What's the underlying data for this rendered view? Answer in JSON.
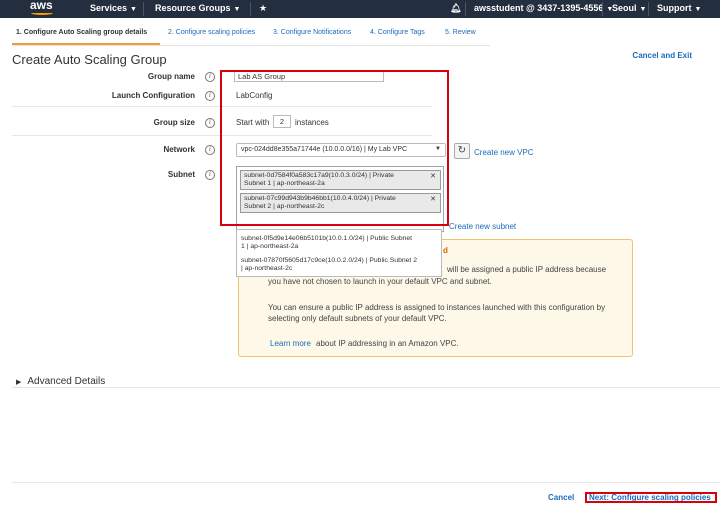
{
  "nav": {
    "logo": "aws",
    "services": "Services",
    "resource_groups": "Resource Groups",
    "account": "awsstudent @ 3437-1395-4556",
    "region": "Seoul",
    "support": "Support"
  },
  "tabs": [
    {
      "label": "1. Configure Auto Scaling group details"
    },
    {
      "label": "2. Configure scaling policies"
    },
    {
      "label": "3. Configure Notifications"
    },
    {
      "label": "4. Configure Tags"
    },
    {
      "label": "5. Review"
    }
  ],
  "header": {
    "title": "Create Auto Scaling Group",
    "cancel_exit": "Cancel and Exit"
  },
  "form": {
    "group_name_label": "Group name",
    "group_name_value": "Lab AS Group",
    "launch_config_label": "Launch Configuration",
    "launch_config_value": "LabConfig",
    "group_size_label": "Group size",
    "start_with": "Start with",
    "group_size_value": "2",
    "instances": "instances",
    "network_label": "Network",
    "network_value": "vpc-024dd8e355a71744e (10.0.0.0/16) | My Lab VPC",
    "create_vpc": "Create new VPC",
    "subnet_label": "Subnet",
    "selected_subnets": [
      {
        "line1": "subnet-0d7584f0a583c17a9(10.0.3.0/24) | Private",
        "line2": "Subnet 1 | ap-northeast-2a"
      },
      {
        "line1": "subnet-07c99d943b9b46bb1(10.0.4.0/24) | Private",
        "line2": "Subnet 2 | ap-northeast-2c"
      }
    ],
    "create_subnet": "Create new subnet",
    "dropdown_options": [
      {
        "line1": "subnet-0f5d9e14e06b5101b(10.0.1.0/24) | Public Subnet",
        "line2": "1 | ap-northeast-2a"
      },
      {
        "line1": "subnet-07870f5605d17c9ce(10.0.2.0/24) | Public Subnet 2",
        "line2": "| ap-northeast-2c"
      }
    ]
  },
  "warning": {
    "title_fragment": "d",
    "line1": "will be assigned a public IP address because",
    "line2": "you have not chosen to launch in your default VPC and subnet.",
    "para2_line1": "You can ensure a public IP address is assigned to instances launched with this configuration by",
    "para2_line2": "selecting only default subnets of your default VPC.",
    "learn_more": "Learn more",
    "learn_more_rest": "about IP addressing in an Amazon VPC."
  },
  "advanced": "Advanced Details",
  "footer": {
    "cancel": "Cancel",
    "next": "Next: Configure scaling policies"
  }
}
